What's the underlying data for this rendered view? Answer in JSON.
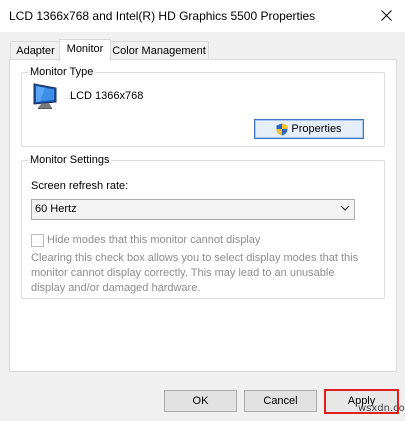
{
  "window": {
    "title": "LCD 1366x768 and Intel(R) HD Graphics 5500 Properties",
    "close_icon": "close-icon"
  },
  "tabs": [
    {
      "label": "Adapter",
      "active": false
    },
    {
      "label": "Monitor",
      "active": true
    },
    {
      "label": "Color Management",
      "active": false
    }
  ],
  "monitor_type": {
    "group_label": "Monitor Type",
    "monitor_name": "LCD 1366x768",
    "icon": "monitor-icon",
    "properties_button": "Properties",
    "properties_icon": "shield-icon"
  },
  "monitor_settings": {
    "group_label": "Monitor Settings",
    "refresh_label": "Screen refresh rate:",
    "refresh_value": "60 Hertz",
    "hide_modes_label": "Hide modes that this monitor cannot display",
    "hide_modes_checked": false,
    "description": "Clearing this check box allows you to select display modes that this monitor cannot display correctly. This may lead to an unusable display and/or damaged hardware."
  },
  "buttons": {
    "ok": "OK",
    "cancel": "Cancel",
    "apply": "Apply"
  },
  "watermark": "wsxdn.com",
  "colors": {
    "apply_highlight": "#e0201f",
    "accent": "#3c76c2"
  }
}
